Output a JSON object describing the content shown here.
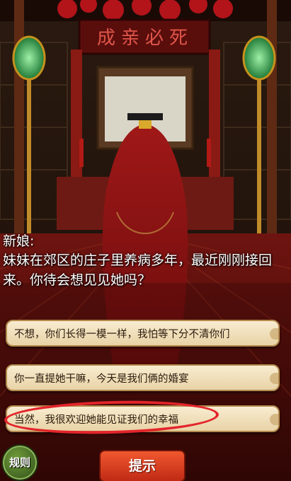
{
  "banner": {
    "text": "成亲必死"
  },
  "dialog": {
    "speaker": "新娘:",
    "line": "妹妹在郊区的庄子里养病多年，最近刚刚接回来。你待会想见见她吗？"
  },
  "choices": [
    {
      "label": "不想，你们长得一模一样，我怕等下分不清你们"
    },
    {
      "label": "你一直提她干嘛，今天是我们俩的婚宴"
    },
    {
      "label": "当然，我很欢迎她能见证我们的幸福"
    }
  ],
  "buttons": {
    "rules": "规则",
    "hint": "提示"
  },
  "colors": {
    "annotation_ring": "#e3242b",
    "hint_button": "#e2492a",
    "rules_button": "#4d7a28"
  }
}
